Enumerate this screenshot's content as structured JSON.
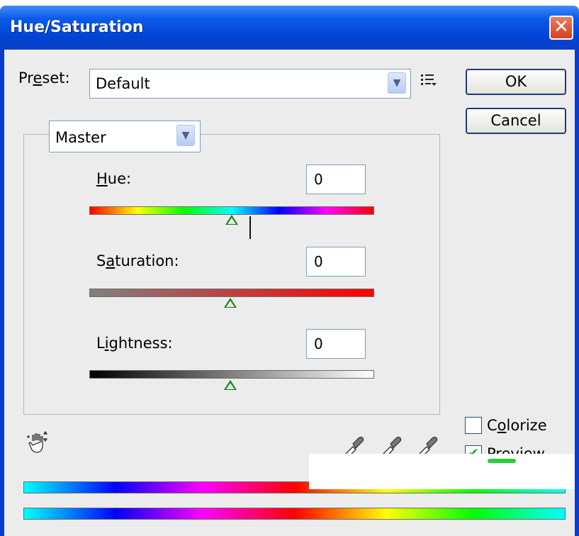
{
  "window": {
    "title": "Hue/Saturation"
  },
  "preset": {
    "label_pre": "Pr",
    "label_ul": "e",
    "label_post": "set:",
    "value": "Default"
  },
  "buttons": {
    "ok": "OK",
    "cancel": "Cancel"
  },
  "channel": {
    "value": "Master"
  },
  "hue": {
    "label_ul": "H",
    "label_post": "ue:",
    "value": "0"
  },
  "saturation": {
    "label_pre": "S",
    "label_ul": "a",
    "label_post": "turation:",
    "value": "0"
  },
  "lightness": {
    "label_pre": "L",
    "label_ul": "i",
    "label_post": "ghtness:",
    "value": "0"
  },
  "colorize": {
    "label_pre": "C",
    "label_ul": "o",
    "label_post": "lorize",
    "checked": false
  },
  "preview": {
    "label_ul": "P",
    "label_post": "review",
    "checked": true
  },
  "icons": {
    "close": "close-icon",
    "options": "preset-options-icon",
    "hand": "targeted-adjustment-hand-icon",
    "eyedropper": "eyedropper-icon",
    "eyedropper_plus": "eyedropper-plus-icon",
    "eyedropper_minus": "eyedropper-minus-icon"
  }
}
